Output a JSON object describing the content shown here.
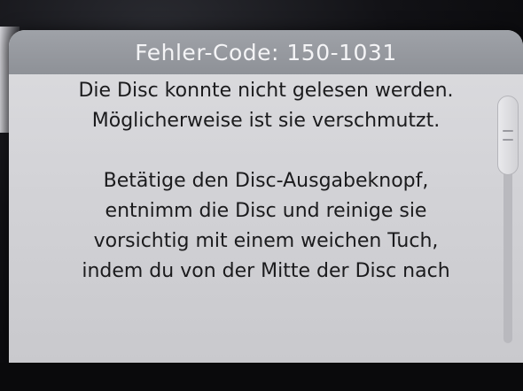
{
  "dialog": {
    "title": "Fehler-Code: 150-1031",
    "paragraph1": [
      "Die Disc konnte nicht gelesen werden.",
      "Möglicherweise ist sie verschmutzt."
    ],
    "paragraph2": [
      "Betätige den Disc-Ausgabeknopf,",
      "entnimm die Disc und reinige sie",
      "vorsichtig mit einem weichen Tuch,",
      "indem du von der Mitte der Disc nach"
    ]
  },
  "icons": {
    "scroll_grip": "grip-icon"
  }
}
